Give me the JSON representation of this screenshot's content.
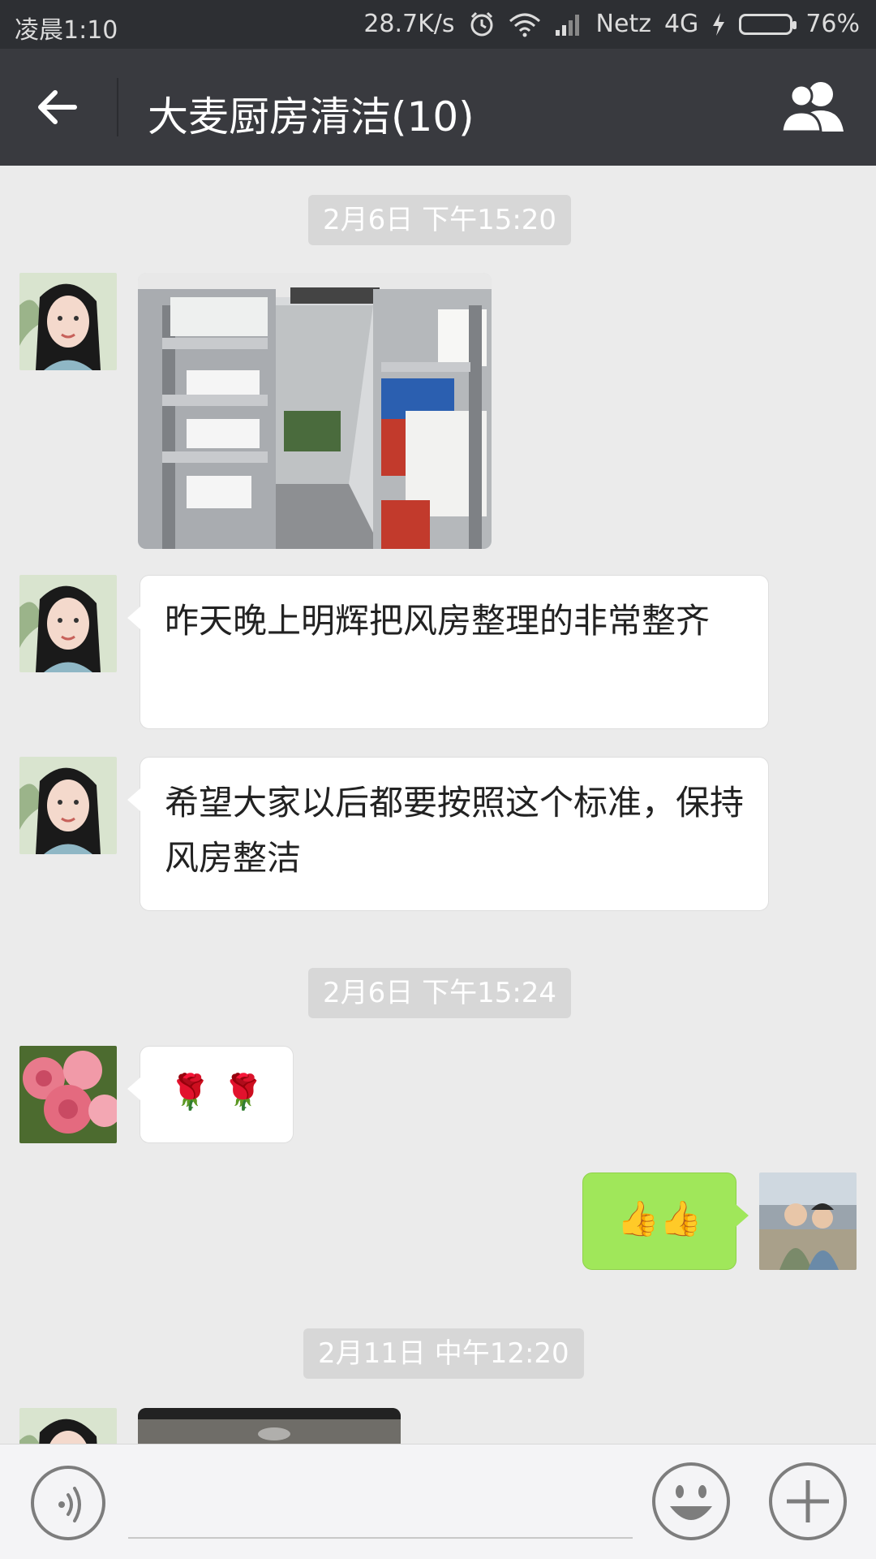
{
  "status_bar": {
    "time": "凌晨1:10",
    "speed": "28.7K/s",
    "carrier": "Netz",
    "network": "4G",
    "battery": "76%",
    "battery_level": 0.76,
    "icons": [
      "alarm-icon",
      "wifi-icon",
      "signal-icon",
      "charging-icon",
      "battery-icon"
    ]
  },
  "header": {
    "title": "大麦厨房清洁(10)",
    "back_icon": "back-arrow-icon",
    "members_icon": "group-members-icon"
  },
  "messages": {
    "ts1": "2月6日 下午15:20",
    "msg2_text": "昨天晚上明辉把风房整理的非常整齐",
    "msg3_text": "希望大家以后都要按照这个标准，保持风房整洁",
    "ts2": "2月6日 下午15:24",
    "msg4_text": "🌹 🌹",
    "msg5_text": "👍👍",
    "ts3": "2月11日 中午12:20"
  },
  "input_bar": {
    "voice_icon": "voice-icon",
    "emoji_icon": "emoji-icon",
    "plus_icon": "plus-icon"
  },
  "colors": {
    "title_bar": "#393a3f",
    "status_bar": "#2d2f33",
    "chat_bg": "#ebebeb",
    "sent_bubble": "#a0e75a"
  }
}
